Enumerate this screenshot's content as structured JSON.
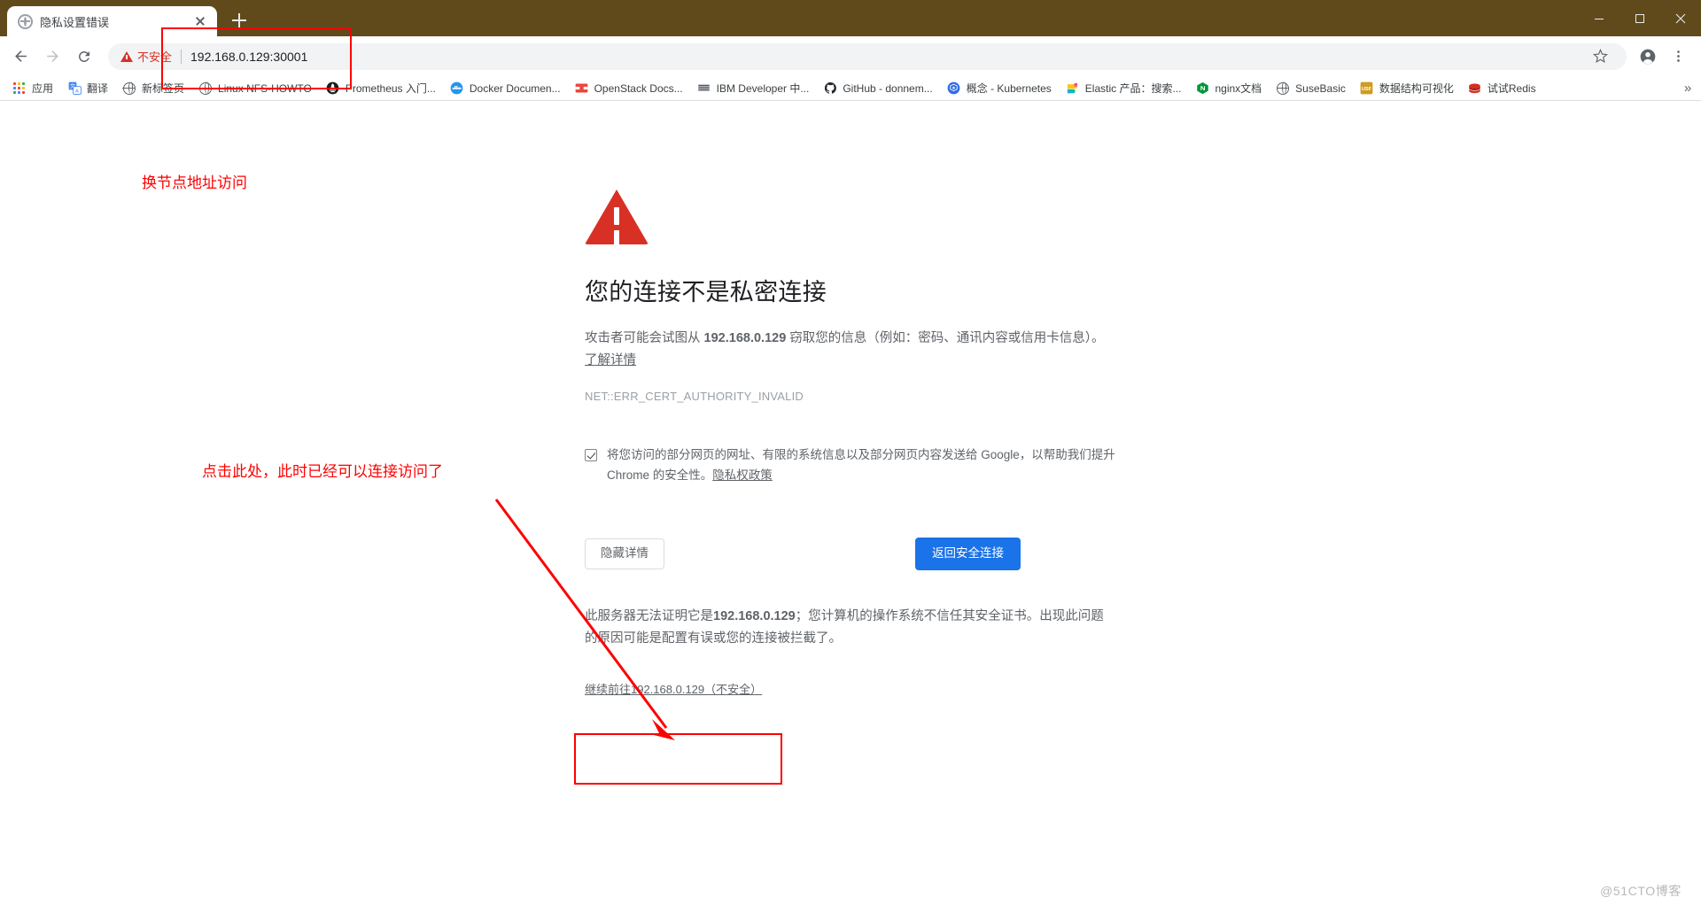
{
  "window": {
    "controls": {
      "minimize": "minimize-icon",
      "maximize": "maximize-icon",
      "close": "close-icon"
    }
  },
  "tabs": [
    {
      "title": "隐私设置错误",
      "favicon": "globe-icon",
      "active": true
    }
  ],
  "new_tab_label": "+",
  "toolbar": {
    "back": "back-arrow-icon",
    "forward": "forward-arrow-icon",
    "reload": "reload-icon",
    "security_label": "不安全",
    "url": "192.168.0.129:30001",
    "star": "star-icon",
    "profile": "profile-avatar-icon",
    "menu": "three-dot-menu-icon"
  },
  "bookmarks": {
    "overflow_label": "»",
    "items": [
      {
        "label": "应用",
        "icon": "apps-grid-icon",
        "color": "#4285f4"
      },
      {
        "label": "翻译",
        "icon": "translate-icon",
        "color": "#1a73e8"
      },
      {
        "label": "新标签页",
        "icon": "globe-icon",
        "color": "#5f6368"
      },
      {
        "label": "Linux NFS-HOWTO",
        "icon": "globe-icon",
        "color": "#5f6368"
      },
      {
        "label": "Prometheus 入门...",
        "icon": "prometheus-icon",
        "color": "#1d1d1d"
      },
      {
        "label": "Docker Documen...",
        "icon": "docker-icon",
        "color": "#2496ed"
      },
      {
        "label": "OpenStack Docs...",
        "icon": "openstack-icon",
        "color": "#e8453c"
      },
      {
        "label": "IBM Developer 中...",
        "icon": "ibm-icon",
        "color": "#1f2933"
      },
      {
        "label": "GitHub - donnem...",
        "icon": "github-icon",
        "color": "#24292e"
      },
      {
        "label": "概念 - Kubernetes",
        "icon": "kubernetes-icon",
        "color": "#326ce5"
      },
      {
        "label": "Elastic 产品：搜索...",
        "icon": "elastic-icon",
        "color": "#fec514"
      },
      {
        "label": "nginx文档",
        "icon": "nginx-icon",
        "color": "#009639"
      },
      {
        "label": "SuseBasic",
        "icon": "globe-icon",
        "color": "#5f6368"
      },
      {
        "label": "数据结构可视化",
        "icon": "usf-icon",
        "color": "#cf9c1f"
      },
      {
        "label": "试试Redis",
        "icon": "redis-icon",
        "color": "#d82c20"
      }
    ]
  },
  "interstitial": {
    "icon": "red-warning-triangle-icon",
    "title": "您的连接不是私密连接",
    "body_before_host": "攻击者可能会试图从 ",
    "host": "192.168.0.129",
    "body_after_host": " 窃取您的信息（例如：密码、通讯内容或信用卡信息）。",
    "learn_more": "了解详情",
    "error_code": "NET::ERR_CERT_AUTHORITY_INVALID",
    "optin_text": "将您访问的部分网页的网址、有限的系统信息以及部分网页内容发送给 Google，以帮助我们提升 Chrome 的安全性。",
    "privacy_policy": "隐私权政策",
    "checkbox_checked": true,
    "hide_details_button": "隐藏详情",
    "back_to_safety_button": "返回安全连接",
    "detail_before_host": "此服务器无法证明它是",
    "detail_host": "192.168.0.129",
    "detail_after_host": "；您计算机的操作系统不信任其安全证书。出现此问题的原因可能是配置有误或您的连接被拦截了。",
    "proceed_link": "继续前往192.168.0.129（不安全）",
    "primary_color": "#1a73e8",
    "error_color": "#d93025"
  },
  "annotations": {
    "color": "#ff0000",
    "note_top": "换节点地址访问",
    "note_bottom": "点击此处，此时已经可以连接访问了"
  },
  "watermark": "@51CTO博客"
}
